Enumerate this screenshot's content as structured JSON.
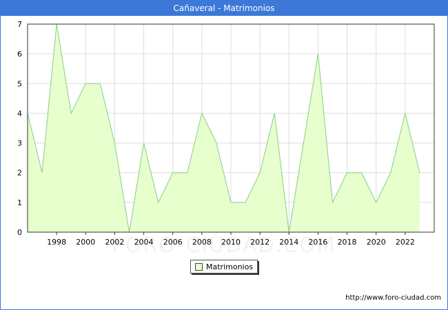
{
  "title": "Cañaveral - Matrimonios",
  "source": "http://www.foro-ciudad.com",
  "watermark": "FORO-CIUDAD.COM",
  "colors": {
    "header": "#3c78d8",
    "fill": "#e6ffcc",
    "line": "#88cc88",
    "grid": "#dddddd"
  },
  "chart_data": {
    "type": "area",
    "title": "Cañaveral - Matrimonios",
    "xlabel": "",
    "ylabel": "",
    "x": [
      1996,
      1997,
      1998,
      1999,
      2000,
      2001,
      2002,
      2003,
      2004,
      2005,
      2006,
      2007,
      2008,
      2009,
      2010,
      2011,
      2012,
      2013,
      2014,
      2015,
      2016,
      2017,
      2018,
      2019,
      2020,
      2021,
      2022,
      2023
    ],
    "series": [
      {
        "name": "Matrimonios",
        "values": [
          4,
          2,
          7,
          4,
          5,
          5,
          3,
          0,
          3,
          1,
          2,
          2,
          4,
          3,
          1,
          1,
          2,
          4,
          0,
          3,
          6,
          1,
          2,
          2,
          1,
          2,
          4,
          2
        ]
      }
    ],
    "xticks": [
      "1998",
      "2000",
      "2002",
      "2004",
      "2006",
      "2008",
      "2010",
      "2012",
      "2014",
      "2016",
      "2018",
      "2020",
      "2022"
    ],
    "yticks": [
      "0",
      "1",
      "2",
      "3",
      "4",
      "5",
      "6",
      "7"
    ],
    "xlim": [
      1996,
      2024
    ],
    "ylim": [
      0,
      7
    ],
    "grid": true,
    "legend_position": "bottom"
  }
}
